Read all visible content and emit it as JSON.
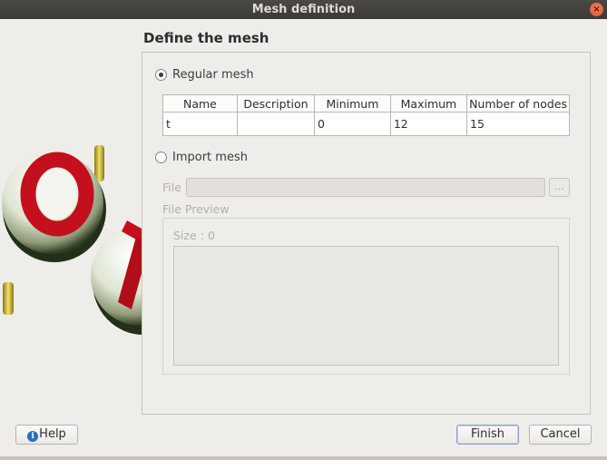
{
  "window": {
    "title": "Mesh definition",
    "close_icon": "close-icon"
  },
  "page": {
    "title": "Define the mesh"
  },
  "regular": {
    "label": "Regular mesh",
    "selected": true,
    "table": {
      "headers": [
        "Name",
        "Description",
        "Minimum",
        "Maximum",
        "Number of nodes"
      ],
      "rows": [
        [
          "t",
          "",
          "0",
          "12",
          "15"
        ]
      ]
    }
  },
  "import": {
    "label": "Import mesh",
    "selected": false,
    "file_label": "File",
    "file_value": "",
    "browse_label": "...",
    "preview_label": "File Preview",
    "size_label": "Size :",
    "size_value": "0"
  },
  "buttons": {
    "help": "Help",
    "finish": "Finish",
    "cancel": "Cancel"
  },
  "colors": {
    "accent": "#2a6dc4",
    "titlebar": "#3b3a37",
    "close": "#e0522a"
  }
}
